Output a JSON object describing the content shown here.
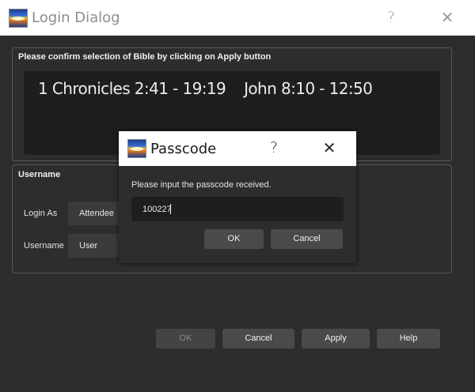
{
  "window": {
    "title": "Login Dialog",
    "help_label": "?",
    "close_label": "✕"
  },
  "bible_group": {
    "title": "Please confirm selection of Bible by clicking on Apply button",
    "selection_text": "1 Chronicles 2:41 - 19:19    John 8:10 - 12:50"
  },
  "username_group": {
    "title": "Username",
    "login_as_label": "Login As",
    "login_as_value": "Attendee",
    "username_label": "Username",
    "username_value": "User"
  },
  "footer_buttons": {
    "ok": "OK",
    "cancel": "Cancel",
    "apply": "Apply",
    "help": "Help"
  },
  "passcode_dialog": {
    "title": "Passcode",
    "help_label": "?",
    "close_label": "✕",
    "prompt": "Please input the passcode received.",
    "input_value": "100227",
    "ok": "OK",
    "cancel": "Cancel"
  },
  "colors": {
    "background": "#2d2d2d",
    "titlebar": "#ffffff",
    "display_box": "#1e1e1e"
  }
}
